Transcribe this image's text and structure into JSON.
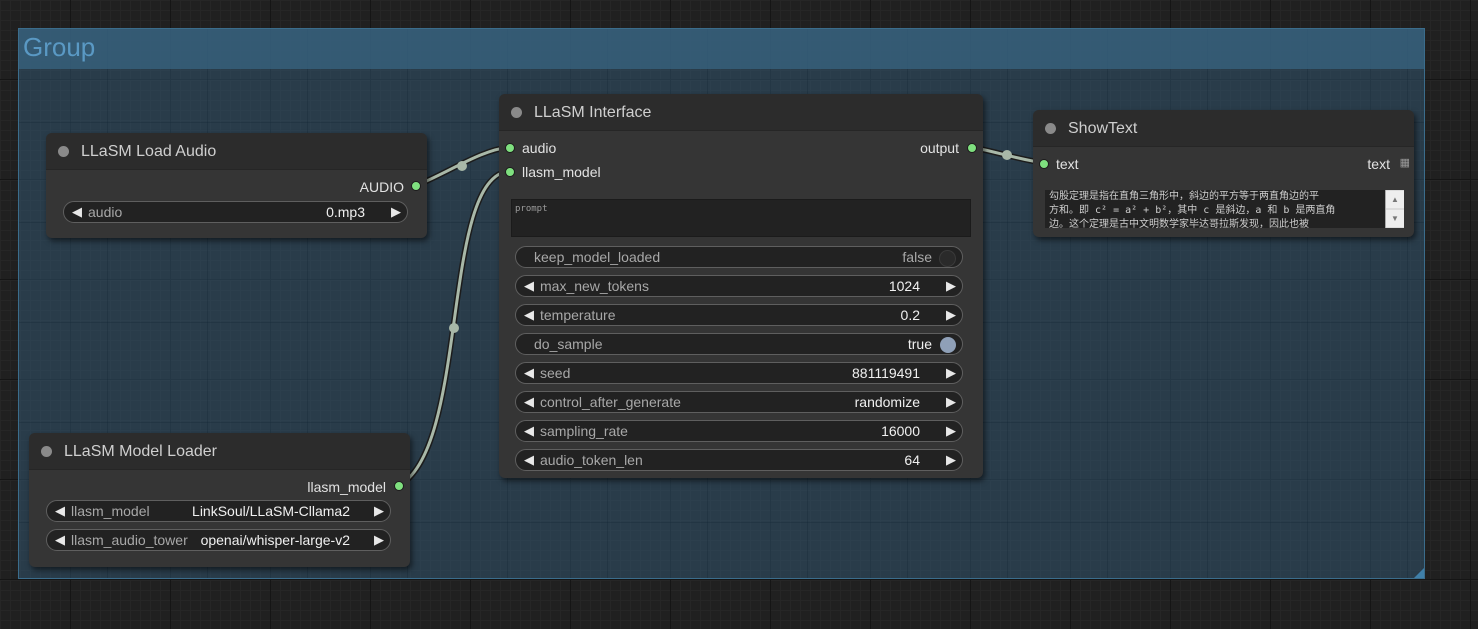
{
  "group": {
    "title": "Group"
  },
  "nodes": {
    "load_audio": {
      "title": "LLaSM Load Audio",
      "output": "AUDIO",
      "widget": {
        "label": "audio",
        "value": "0.mp3"
      }
    },
    "model_loader": {
      "title": "LLaSM Model Loader",
      "output": "llasm_model",
      "widgets": [
        {
          "label": "llasm_model",
          "value": "LinkSoul/LLaSM-Cllama2"
        },
        {
          "label": "llasm_audio_tower",
          "value": "openai/whisper-large-v2"
        }
      ]
    },
    "interface": {
      "title": "LLaSM Interface",
      "inputs": [
        "audio",
        "llasm_model"
      ],
      "output": "output",
      "prompt_placeholder": "prompt",
      "widgets": [
        {
          "label": "keep_model_loaded",
          "value": "false",
          "kind": "toggle",
          "on": false
        },
        {
          "label": "max_new_tokens",
          "value": "1024",
          "kind": "number"
        },
        {
          "label": "temperature",
          "value": "0.2",
          "kind": "number"
        },
        {
          "label": "do_sample",
          "value": "true",
          "kind": "toggle",
          "on": true
        },
        {
          "label": "seed",
          "value": "881119491",
          "kind": "number"
        },
        {
          "label": "control_after_generate",
          "value": "randomize",
          "kind": "combo"
        },
        {
          "label": "sampling_rate",
          "value": "16000",
          "kind": "number"
        },
        {
          "label": "audio_token_len",
          "value": "64",
          "kind": "number"
        }
      ]
    },
    "show_text": {
      "title": "ShowText",
      "input": "text",
      "output": "text",
      "text_lines": [
        "勾股定理是指在直角三角形中，斜边的平方等于两直角边的平",
        "方和。即 c² = a² + b²，其中 c 是斜边，a 和 b 是两直角",
        "边。这个定理是古中文明数学家毕达哥拉斯发现，因此也被"
      ]
    }
  },
  "glyphs": {
    "arrow_left": "◀",
    "arrow_right": "▶",
    "scroll_up": "▲",
    "scroll_down": "▼",
    "grid": "▦"
  },
  "colors": {
    "slot_connected": "#7fe07f",
    "link": "#a8b8a8",
    "toggle_on": "#8fa0b8",
    "toggle_off": "#2a2a2a",
    "group_title": "#5a99c4"
  }
}
